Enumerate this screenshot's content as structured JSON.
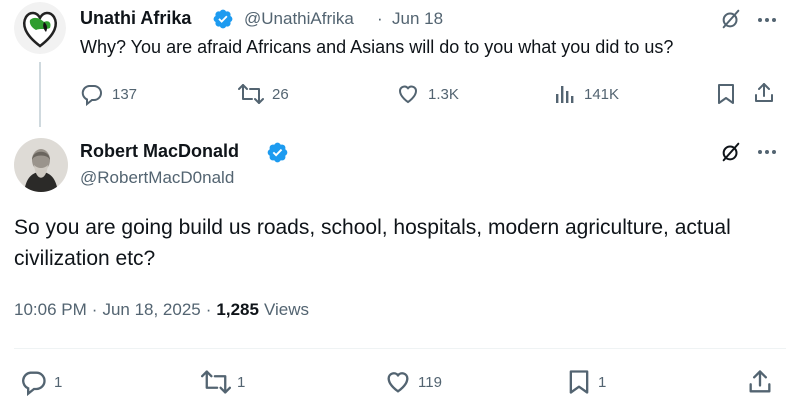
{
  "parent_tweet": {
    "name": "Unathi Afrika",
    "handle": "@UnathiAfrika",
    "separator": "·",
    "date": "Jun 18",
    "text": "Why? You are afraid Africans and Asians will do to you what you did to us?",
    "replies": "137",
    "reposts": "26",
    "likes": "1.3K",
    "views": "141K"
  },
  "main_tweet": {
    "name": "Robert MacDonald",
    "handle": "@RobertMacD0nald",
    "text": "So you are going build us roads, school, hospitals, modern agriculture, actual civilization etc?",
    "time": "10:06 PM",
    "dot1": "·",
    "date": "Jun 18, 2025",
    "dot2": "·",
    "views_count": "1,285",
    "views_label": "Views",
    "replies": "1",
    "reposts": "1",
    "likes": "119",
    "bookmarks": "1"
  },
  "colors": {
    "verified": "#1d9bf0",
    "muted": "#536471",
    "text": "#0f1419",
    "thread_line": "#cfd9de"
  },
  "icons": [
    "reply-icon",
    "repost-icon",
    "like-icon",
    "views-icon",
    "bookmark-icon",
    "share-icon",
    "grok-icon",
    "more-icon",
    "verified-icon"
  ]
}
